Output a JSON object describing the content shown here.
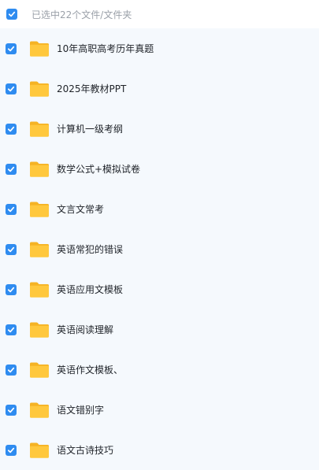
{
  "header": {
    "selection_text": "已选中22个文件/文件夹"
  },
  "items": [
    {
      "name": "10年高职高考历年真题",
      "checked": true
    },
    {
      "name": "2025年教材PPT",
      "checked": true
    },
    {
      "name": "计算机一级考纲",
      "checked": true
    },
    {
      "name": "数学公式+模拟试卷",
      "checked": true
    },
    {
      "name": "文言文常考",
      "checked": true
    },
    {
      "name": "英语常犯的错误",
      "checked": true
    },
    {
      "name": "英语应用文模板",
      "checked": true
    },
    {
      "name": "英语阅读理解",
      "checked": true
    },
    {
      "name": "英语作文模板、",
      "checked": true
    },
    {
      "name": "语文错别字",
      "checked": true
    },
    {
      "name": "语文古诗技巧",
      "checked": true
    }
  ],
  "icons": {
    "checkbox": "check-icon",
    "folder": "folder-icon"
  },
  "colors": {
    "accent": "#2f8cf0",
    "folder_front": "#ffc83d",
    "folder_back": "#f5b324",
    "list_background": "#f5f9fd"
  }
}
